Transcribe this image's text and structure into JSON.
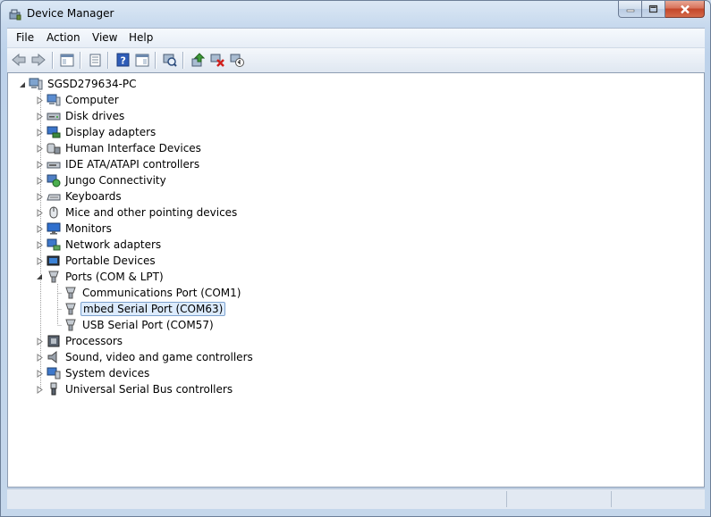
{
  "window": {
    "title": "Device Manager",
    "icon": "device-manager-icon"
  },
  "caption_buttons": {
    "minimize": "minimize-icon",
    "maximize": "maximize-icon",
    "close": "close-icon"
  },
  "menu": {
    "items": [
      "File",
      "Action",
      "View",
      "Help"
    ]
  },
  "toolbar": {
    "buttons": [
      "back-arrow-icon",
      "forward-arrow-icon",
      "show-hide-console-tree-icon",
      "properties-icon",
      "help-icon",
      "show-hide-action-pane-icon",
      "scan-hardware-changes-icon",
      "update-driver-icon",
      "uninstall-icon",
      "disable-device-icon"
    ]
  },
  "tree": {
    "root": "SGSD279634-PC",
    "categories": [
      "Computer",
      "Disk drives",
      "Display adapters",
      "Human Interface Devices",
      "IDE ATA/ATAPI controllers",
      "Jungo Connectivity",
      "Keyboards",
      "Mice and other pointing devices",
      "Monitors",
      "Network adapters",
      "Portable Devices",
      "Ports (COM & LPT)",
      "Processors",
      "Sound, video and game controllers",
      "System devices",
      "Universal Serial Bus controllers"
    ],
    "ports_children": [
      "Communications Port (COM1)",
      "mbed Serial Port (COM63)",
      "USB Serial Port (COM57)"
    ],
    "selected": "mbed Serial Port (COM63)"
  }
}
